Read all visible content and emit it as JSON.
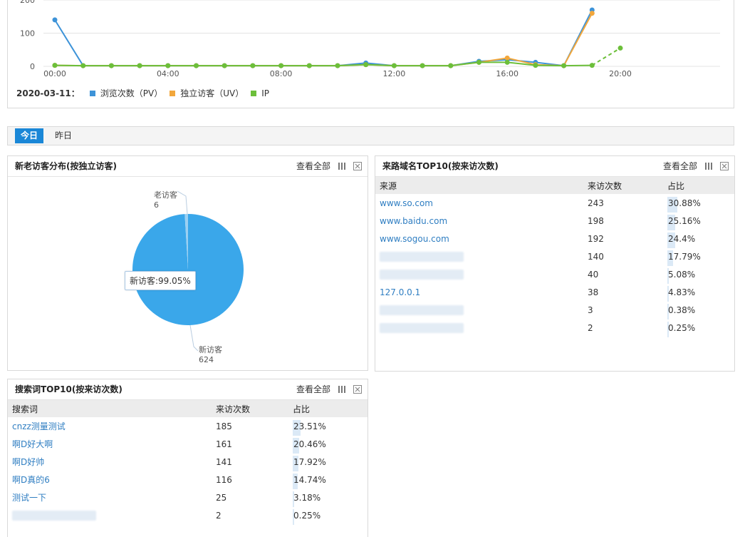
{
  "trend": {
    "y_ticks": [
      "200",
      "100",
      "0"
    ],
    "x_ticks": [
      "00:00",
      "04:00",
      "08:00",
      "12:00",
      "16:00",
      "20:00"
    ],
    "legend_date": "2020-03-11：",
    "colors": {
      "pv": "#3d93d8",
      "uv": "#f2a73c",
      "ip": "#6cbf3a"
    },
    "legend": [
      {
        "label": "浏览次数（PV）",
        "color": "#3d93d8"
      },
      {
        "label": "独立访客（UV）",
        "color": "#f2a73c"
      },
      {
        "label": "IP",
        "color": "#6cbf3a"
      }
    ]
  },
  "chart_data": {
    "type": "line",
    "x": [
      "00:00",
      "01:00",
      "02:00",
      "03:00",
      "04:00",
      "05:00",
      "06:00",
      "07:00",
      "08:00",
      "09:00",
      "10:00",
      "11:00",
      "12:00",
      "13:00",
      "14:00",
      "15:00",
      "16:00",
      "17:00",
      "18:00",
      "19:00",
      "20:00"
    ],
    "ylim": [
      0,
      200
    ],
    "series": [
      {
        "name": "浏览次数（PV）",
        "values": [
          140,
          2,
          2,
          2,
          2,
          2,
          2,
          2,
          2,
          2,
          2,
          10,
          2,
          2,
          2,
          15,
          20,
          12,
          2,
          170,
          null
        ]
      },
      {
        "name": "独立访客（UV）",
        "values": [
          3,
          2,
          2,
          2,
          2,
          2,
          2,
          2,
          2,
          2,
          2,
          5,
          2,
          2,
          2,
          12,
          25,
          5,
          2,
          160,
          null
        ]
      },
      {
        "name": "IP",
        "values": [
          3,
          2,
          2,
          2,
          2,
          2,
          2,
          2,
          2,
          2,
          2,
          5,
          2,
          2,
          2,
          12,
          12,
          3,
          2,
          3,
          55
        ]
      }
    ]
  },
  "tabs": {
    "today": "今日",
    "yesterday": "昨日"
  },
  "pie": {
    "title": "新老访客分布(按独立访客)",
    "view_all": "查看全部",
    "old_label": "老访客",
    "old_value": "6",
    "new_label": "新访客",
    "new_value": "624",
    "tooltip": "新访客:99.05%",
    "new_fraction": 0.9905,
    "color_new": "#3aa7ea",
    "color_old": "#9bd0f2"
  },
  "sources": {
    "title": "来路域名TOP10(按来访次数)",
    "view_all": "查看全部",
    "columns": [
      "来源",
      "来访次数",
      "占比"
    ],
    "rows": [
      {
        "name": "www.so.com",
        "count": "243",
        "pct": "30.88%",
        "frac": 0.3088,
        "blur": false
      },
      {
        "name": "www.baidu.com",
        "count": "198",
        "pct": "25.16%",
        "frac": 0.2516,
        "blur": false
      },
      {
        "name": "www.sogou.com",
        "count": "192",
        "pct": "24.4%",
        "frac": 0.244,
        "blur": false
      },
      {
        "name": "",
        "count": "140",
        "pct": "17.79%",
        "frac": 0.1779,
        "blur": true
      },
      {
        "name": "",
        "count": "40",
        "pct": "5.08%",
        "frac": 0.0508,
        "blur": true
      },
      {
        "name": "127.0.0.1",
        "count": "38",
        "pct": "4.83%",
        "frac": 0.0483,
        "blur": false
      },
      {
        "name": "",
        "count": "3",
        "pct": "0.38%",
        "frac": 0.0038,
        "blur": true
      },
      {
        "name": "",
        "count": "2",
        "pct": "0.25%",
        "frac": 0.0025,
        "blur": true
      }
    ]
  },
  "keywords": {
    "title": "搜索词TOP10(按来访次数)",
    "view_all": "查看全部",
    "columns": [
      "搜索词",
      "来访次数",
      "占比"
    ],
    "rows": [
      {
        "name": "cnzz测量测试",
        "count": "185",
        "pct": "23.51%",
        "frac": 0.2351,
        "blur": false
      },
      {
        "name": "啊D好大啊",
        "count": "161",
        "pct": "20.46%",
        "frac": 0.2046,
        "blur": false
      },
      {
        "name": "啊D好帅",
        "count": "141",
        "pct": "17.92%",
        "frac": 0.1792,
        "blur": false
      },
      {
        "name": "啊D真的6",
        "count": "116",
        "pct": "14.74%",
        "frac": 0.1474,
        "blur": false
      },
      {
        "name": "测试一下",
        "count": "25",
        "pct": "3.18%",
        "frac": 0.0318,
        "blur": false
      },
      {
        "name": "",
        "count": "2",
        "pct": "0.25%",
        "frac": 0.0025,
        "blur": true
      }
    ]
  }
}
